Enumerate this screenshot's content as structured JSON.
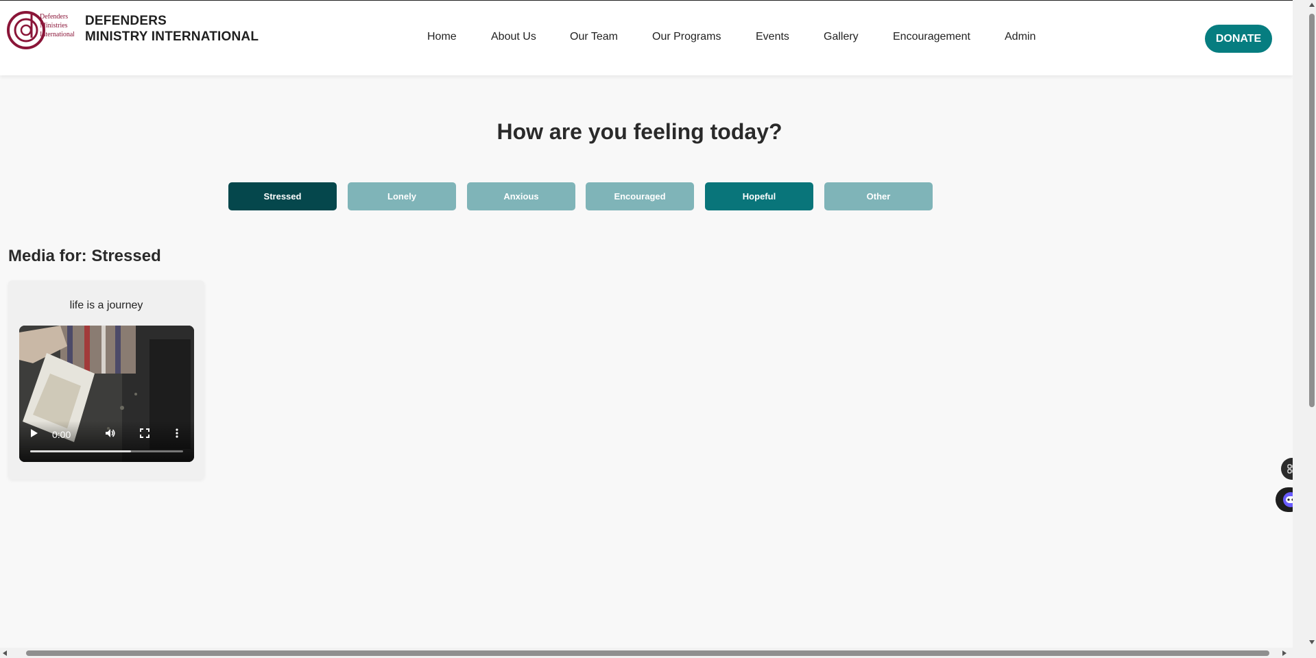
{
  "brand": {
    "logo_text_lines": [
      "Defenders",
      "Ministries",
      "International"
    ],
    "name_line1": "DEFENDERS",
    "name_line2": "MINISTRY INTERNATIONAL"
  },
  "nav": {
    "items": [
      {
        "label": "Home"
      },
      {
        "label": "About Us"
      },
      {
        "label": "Our Team"
      },
      {
        "label": "Our Programs"
      },
      {
        "label": "Events"
      },
      {
        "label": "Gallery"
      },
      {
        "label": "Encouragement"
      },
      {
        "label": "Admin"
      }
    ],
    "donate_label": "DONATE"
  },
  "main": {
    "heading": "How are you feeling today?",
    "moods": [
      {
        "label": "Stressed",
        "state": "selected"
      },
      {
        "label": "Lonely",
        "state": "default"
      },
      {
        "label": "Anxious",
        "state": "default"
      },
      {
        "label": "Encouraged",
        "state": "default"
      },
      {
        "label": "Hopeful",
        "state": "highlighted"
      },
      {
        "label": "Other",
        "state": "default"
      }
    ],
    "media_title": "Media for: Stressed",
    "cards": [
      {
        "title": "life is a journey",
        "video": {
          "time": "0:00",
          "progress_fraction": 0.66,
          "icons": [
            "play-icon",
            "volume-icon",
            "fullscreen-icon",
            "more-options-icon"
          ]
        }
      }
    ]
  },
  "colors": {
    "primary": "#067d80",
    "selected_mood": "#05474c",
    "mood_default": "#7fb4b8",
    "logo": "#8a1538",
    "background": "#f8f8f8"
  },
  "widgets": {
    "icons": [
      "apps-grid-icon",
      "chatbot-icon"
    ]
  }
}
